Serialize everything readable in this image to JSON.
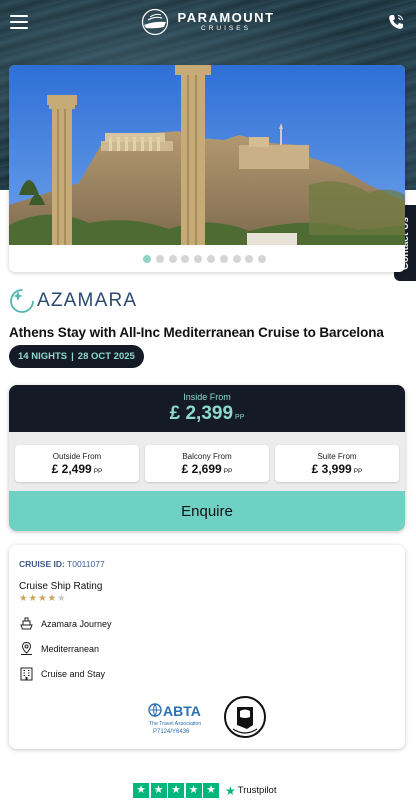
{
  "header": {
    "brand": "PARAMOUNT",
    "brand_sub": "CRUISES"
  },
  "contact_tab": {
    "label": "Contact Us"
  },
  "gallery": {
    "slide_count": 10,
    "active_index": 0
  },
  "cruise": {
    "line": "AZAMARA",
    "title": "Athens Stay with All-Inc Mediterranean Cruise to Barcelona",
    "nights": "14 NIGHTS",
    "separator": "|",
    "date": "28 OCT 2025"
  },
  "pricing": {
    "headline_label": "Inside From",
    "headline_price": "£ 2,399",
    "pp": "PP",
    "options": [
      {
        "label": "Outside From",
        "price": "£ 2,499",
        "pp": "PP"
      },
      {
        "label": "Balcony From",
        "price": "£ 2,699",
        "pp": "PP"
      },
      {
        "label": "Suite From",
        "price": "£ 3,999",
        "pp": "PP"
      }
    ],
    "enquire_label": "Enquire"
  },
  "details": {
    "cruise_id_label": "CRUISE ID:",
    "cruise_id": "T0011077",
    "rating_label": "Cruise Ship Rating",
    "rating": 4,
    "rating_max": 5,
    "features": [
      {
        "icon": "ship-icon",
        "label": "Azamara Journey"
      },
      {
        "icon": "location-pin-icon",
        "label": "Mediterranean"
      },
      {
        "icon": "hotel-building-icon",
        "label": "Cruise and Stay"
      }
    ],
    "abta_code": "P7124/Y6436",
    "abta_tagline": "The Travel Association"
  },
  "trustpilot": {
    "label": "Trustpilot",
    "stars": 5
  },
  "colors": {
    "navy": "#141a26",
    "teal": "#6fd0c4",
    "teal_text": "#8fd9cc",
    "star_gold": "#c8a65a",
    "trustpilot_green": "#00b67a"
  }
}
